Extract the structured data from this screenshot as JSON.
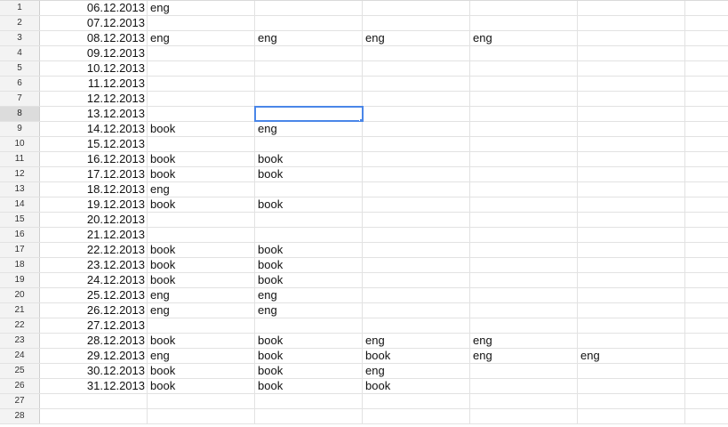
{
  "sheet": {
    "rows": [
      {
        "num": "1",
        "cells": [
          "06.12.2013",
          "eng",
          "",
          "",
          "",
          "",
          ""
        ]
      },
      {
        "num": "2",
        "cells": [
          "07.12.2013",
          "",
          "",
          "",
          "",
          "",
          ""
        ]
      },
      {
        "num": "3",
        "cells": [
          "08.12.2013",
          "eng",
          "eng",
          "eng",
          "eng",
          "",
          ""
        ]
      },
      {
        "num": "4",
        "cells": [
          "09.12.2013",
          "",
          "",
          "",
          "",
          "",
          ""
        ]
      },
      {
        "num": "5",
        "cells": [
          "10.12.2013",
          "",
          "",
          "",
          "",
          "",
          ""
        ]
      },
      {
        "num": "6",
        "cells": [
          "11.12.2013",
          "",
          "",
          "",
          "",
          "",
          ""
        ]
      },
      {
        "num": "7",
        "cells": [
          "12.12.2013",
          "",
          "",
          "",
          "",
          "",
          ""
        ]
      },
      {
        "num": "8",
        "cells": [
          "13.12.2013",
          "",
          "",
          "",
          "",
          "",
          ""
        ]
      },
      {
        "num": "9",
        "cells": [
          "14.12.2013",
          "book",
          "eng",
          "",
          "",
          "",
          ""
        ]
      },
      {
        "num": "10",
        "cells": [
          "15.12.2013",
          "",
          "",
          "",
          "",
          "",
          ""
        ]
      },
      {
        "num": "11",
        "cells": [
          "16.12.2013",
          "book",
          "book",
          "",
          "",
          "",
          ""
        ]
      },
      {
        "num": "12",
        "cells": [
          "17.12.2013",
          "book",
          "book",
          "",
          "",
          "",
          ""
        ]
      },
      {
        "num": "13",
        "cells": [
          "18.12.2013",
          "eng",
          "",
          "",
          "",
          "",
          ""
        ]
      },
      {
        "num": "14",
        "cells": [
          "19.12.2013",
          "book",
          "book",
          "",
          "",
          "",
          ""
        ]
      },
      {
        "num": "15",
        "cells": [
          "20.12.2013",
          "",
          "",
          "",
          "",
          "",
          ""
        ]
      },
      {
        "num": "16",
        "cells": [
          "21.12.2013",
          "",
          "",
          "",
          "",
          "",
          ""
        ]
      },
      {
        "num": "17",
        "cells": [
          "22.12.2013",
          "book",
          "book",
          "",
          "",
          "",
          ""
        ]
      },
      {
        "num": "18",
        "cells": [
          "23.12.2013",
          "book",
          "book",
          "",
          "",
          "",
          ""
        ]
      },
      {
        "num": "19",
        "cells": [
          "24.12.2013",
          "book",
          "book",
          "",
          "",
          "",
          ""
        ]
      },
      {
        "num": "20",
        "cells": [
          "25.12.2013",
          "eng",
          "eng",
          "",
          "",
          "",
          ""
        ]
      },
      {
        "num": "21",
        "cells": [
          "26.12.2013",
          "eng",
          "eng",
          "",
          "",
          "",
          ""
        ]
      },
      {
        "num": "22",
        "cells": [
          "27.12.2013",
          "",
          "",
          "",
          "",
          "",
          ""
        ]
      },
      {
        "num": "23",
        "cells": [
          "28.12.2013",
          "book",
          "book",
          "eng",
          "eng",
          "",
          ""
        ]
      },
      {
        "num": "24",
        "cells": [
          "29.12.2013",
          "eng",
          "book",
          "book",
          "eng",
          "eng",
          ""
        ]
      },
      {
        "num": "25",
        "cells": [
          "30.12.2013",
          "book",
          "book",
          "eng",
          "",
          "",
          ""
        ]
      },
      {
        "num": "26",
        "cells": [
          "31.12.2013",
          "book",
          "book",
          "book",
          "",
          "",
          ""
        ]
      },
      {
        "num": "27",
        "cells": [
          "",
          "",
          "",
          "",
          "",
          "",
          ""
        ]
      },
      {
        "num": "28",
        "cells": [
          "",
          "",
          "",
          "",
          "",
          "",
          ""
        ]
      }
    ]
  },
  "colors": {
    "selection_border": "#4a86e8",
    "row_header_bg": "#f3f3f3",
    "active_row_header_bg": "#dcdcdc",
    "gridline": "#e2e2e2"
  }
}
